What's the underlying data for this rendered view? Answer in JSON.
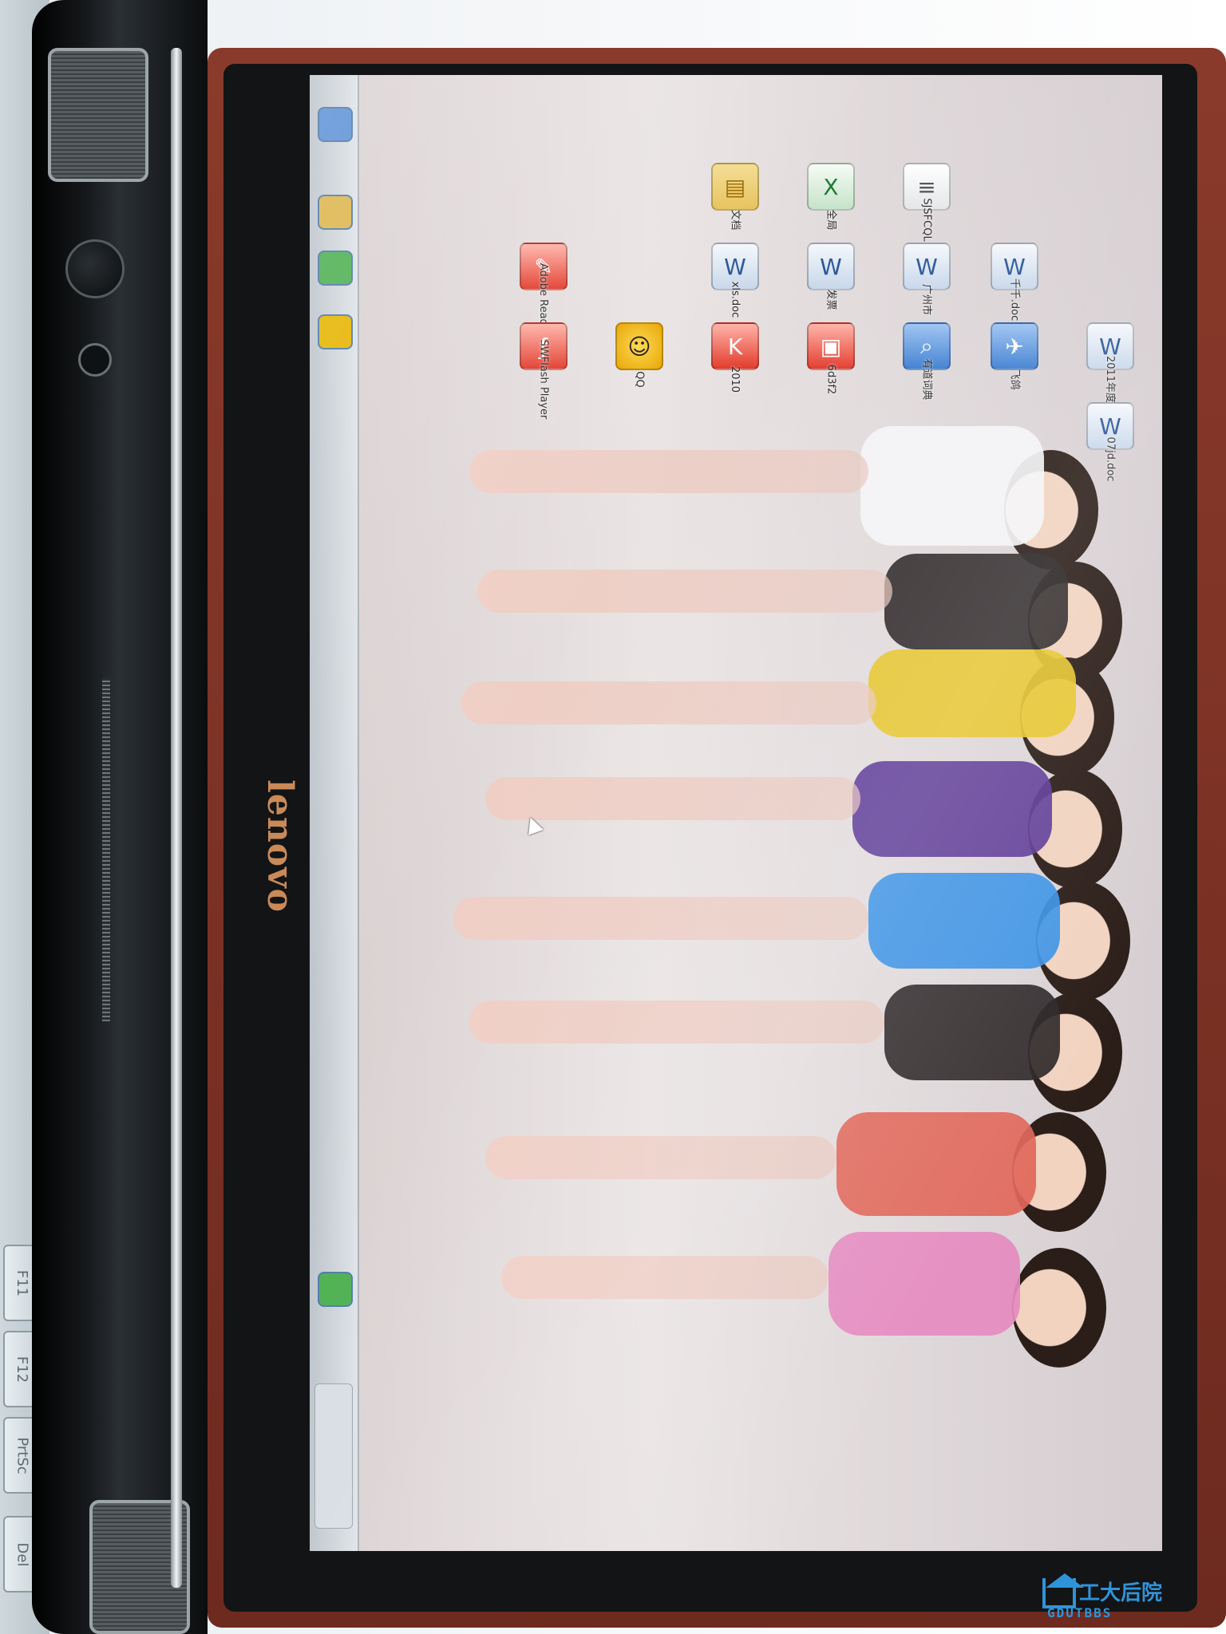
{
  "brand": {
    "logo_text": "lenovo"
  },
  "keyboard": {
    "keys": [
      "F11",
      "F12",
      "PrtSc",
      "Del"
    ]
  },
  "desktop": {
    "icons": [
      {
        "name": "07jd.doc",
        "type": "doc"
      },
      {
        "name": "2011年度",
        "type": "doc"
      },
      {
        "name": "飞鸽",
        "type": "blue"
      },
      {
        "name": "千千.doc",
        "type": "doc"
      },
      {
        "name": "有道词典",
        "type": "blue"
      },
      {
        "name": "广州市",
        "type": "doc"
      },
      {
        "name": "SJSFCQL",
        "type": "txt"
      },
      {
        "name": "6d3f2",
        "type": "app"
      },
      {
        "name": "发票",
        "type": "doc"
      },
      {
        "name": "全局",
        "type": "xls"
      },
      {
        "name": "2010",
        "type": "app"
      },
      {
        "name": "xls.doc",
        "type": "doc"
      },
      {
        "name": "文档",
        "type": "folder"
      },
      {
        "name": "QQ",
        "type": "qq"
      },
      {
        "name": "Adobe Reader",
        "type": "app"
      },
      {
        "name": "SWFlash Player",
        "type": "app"
      }
    ]
  },
  "watermark": {
    "title": "工大后院",
    "subtitle": "GDUTBBS"
  },
  "colors": {
    "screen_bg": "#e6dfe1",
    "lid": "#7a3023",
    "logo": "#c98a58",
    "watermark": "#2f93d8"
  }
}
